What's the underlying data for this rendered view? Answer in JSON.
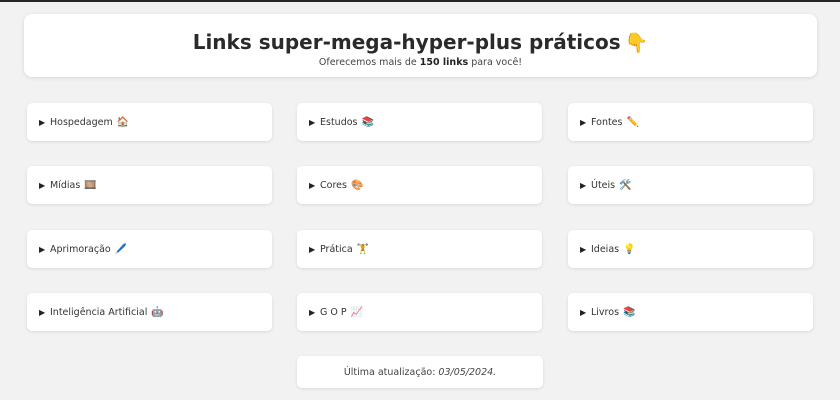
{
  "header": {
    "title": "Links super-mega-hyper-plus práticos",
    "title_emoji": "👇",
    "subtitle_prefix": "Oferecemos mais de ",
    "subtitle_bold": "150 links",
    "subtitle_suffix": " para você!"
  },
  "caret": "▶",
  "categories": [
    {
      "label": "Hospedagem",
      "emoji": "🏠",
      "icon": "house-icon"
    },
    {
      "label": "Estudos",
      "emoji": "📚",
      "icon": "books-icon"
    },
    {
      "label": "Fontes",
      "emoji": "✏️",
      "icon": "pencil-icon"
    },
    {
      "label": "Mídias",
      "emoji": "🎞️",
      "icon": "film-icon"
    },
    {
      "label": "Cores",
      "emoji": "🎨",
      "icon": "palette-icon"
    },
    {
      "label": "Úteis",
      "emoji": "🛠️",
      "icon": "tools-icon"
    },
    {
      "label": "Aprimoração",
      "emoji": "🖊️",
      "icon": "pen-icon"
    },
    {
      "label": "Prática",
      "emoji": "🏋️",
      "icon": "weightlifting-icon"
    },
    {
      "label": "Ideias",
      "emoji": "💡",
      "icon": "lightbulb-icon"
    },
    {
      "label": "Inteligência Artificial",
      "emoji": "🤖",
      "icon": "robot-icon"
    },
    {
      "label": "G O P",
      "emoji": "📈",
      "icon": "chart-icon"
    },
    {
      "label": "Livros",
      "emoji": "📚",
      "icon": "books-icon"
    }
  ],
  "footer": {
    "prefix": "Última atualização:",
    "date": "03/05/2024."
  }
}
